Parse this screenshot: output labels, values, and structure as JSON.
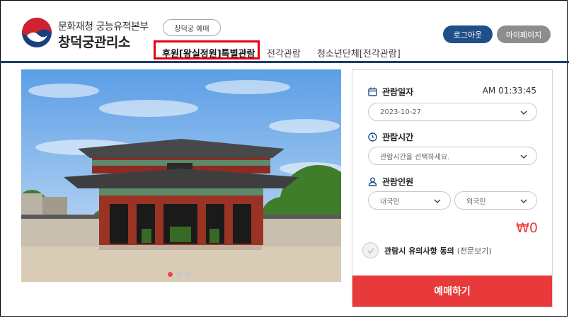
{
  "header": {
    "org_top": "문화재청 궁능유적본부",
    "org_main": "창덕궁관리소",
    "reserve_pill": "창덕궁 예매",
    "tabs": [
      {
        "label": "후원[왕실정원]특별관람",
        "active": true
      },
      {
        "label": "전각관람",
        "active": false
      },
      {
        "label": "청소년단체[전각관람]",
        "active": false
      }
    ],
    "logout_label": "로그아웃",
    "mypage_label": "마이페이지"
  },
  "carousel": {
    "image_text": "",
    "slides": 3,
    "active_index": 0
  },
  "booking": {
    "date_title": "관람일자",
    "clock": "AM 01:33:45",
    "date_value": "2023-10-27",
    "time_title": "관람시간",
    "time_placeholder": "관람시간을 선택하세요.",
    "people_title": "관람인원",
    "domestic_label": "내국인",
    "foreign_label": "외국인",
    "price": "₩0",
    "agree_label": "관람시 유의사항 동의",
    "agree_link": "(전문보기)",
    "submit_label": "예매하기"
  },
  "colors": {
    "navy": "#1f4e88",
    "accent_red": "#e83a3a",
    "highlight": "#e60012"
  }
}
